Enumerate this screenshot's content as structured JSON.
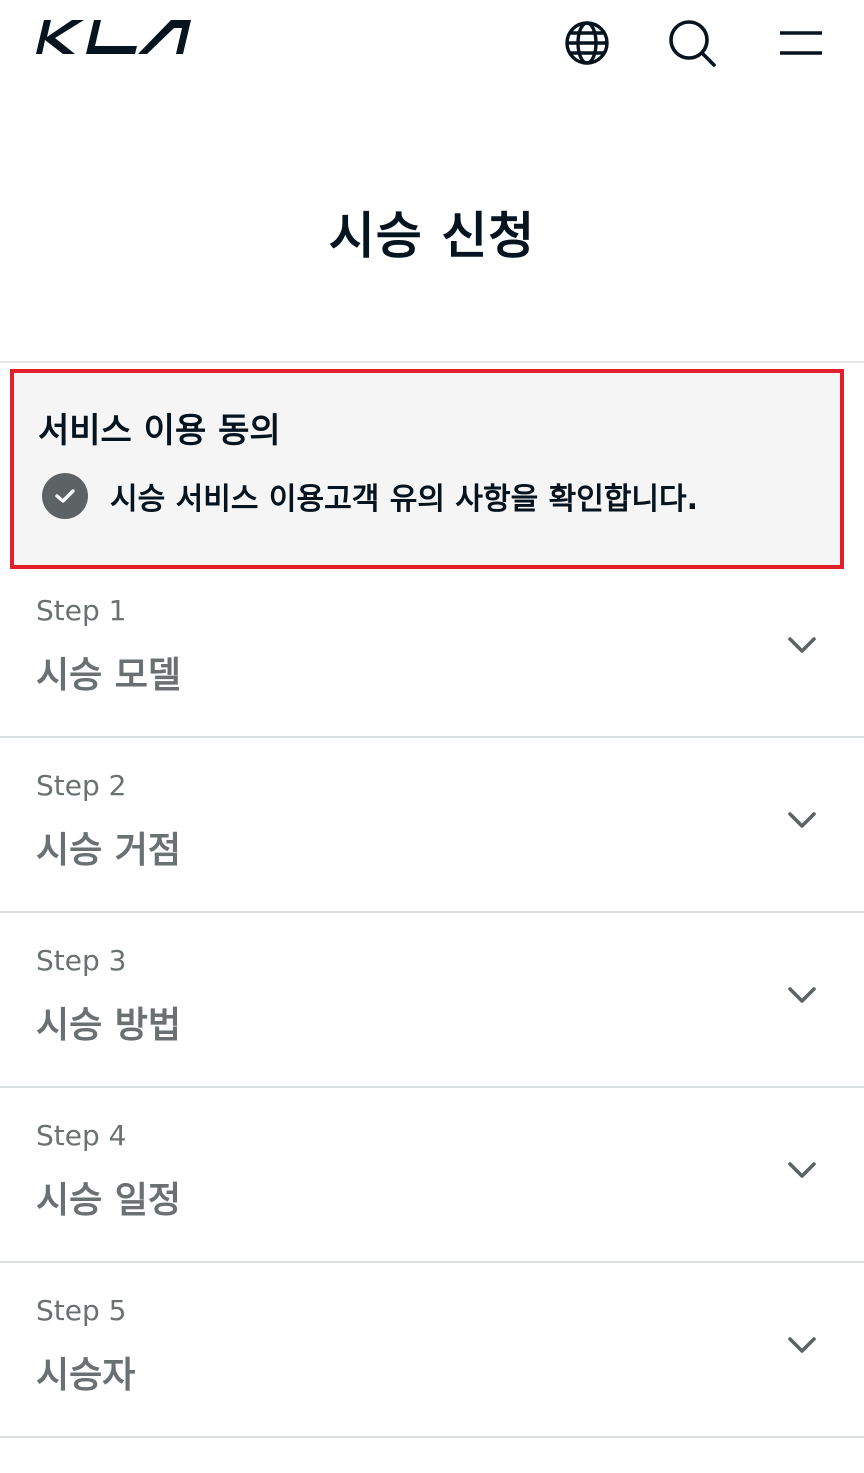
{
  "header": {
    "logo_text": "KIA",
    "icons": {
      "language": "globe-icon",
      "search": "search-icon",
      "menu": "hamburger-menu-icon"
    }
  },
  "page_title": "시승 신청",
  "consent": {
    "title": "서비스 이용 동의",
    "item_label": "시승 서비스 이용고객 유의 사항을 확인합니다.",
    "checked": true,
    "highlight_color": "#e2202c"
  },
  "steps": [
    {
      "label": "Step 1",
      "name": "시승 모델"
    },
    {
      "label": "Step 2",
      "name": "시승 거점"
    },
    {
      "label": "Step 3",
      "name": "시승 방법"
    },
    {
      "label": "Step 4",
      "name": "시승 일정"
    },
    {
      "label": "Step 5",
      "name": "시승자"
    }
  ],
  "colors": {
    "text_primary": "#05141f",
    "text_muted": "#6b7073",
    "panel_bg": "#f5f5f5",
    "check_bg": "#5d6265"
  }
}
